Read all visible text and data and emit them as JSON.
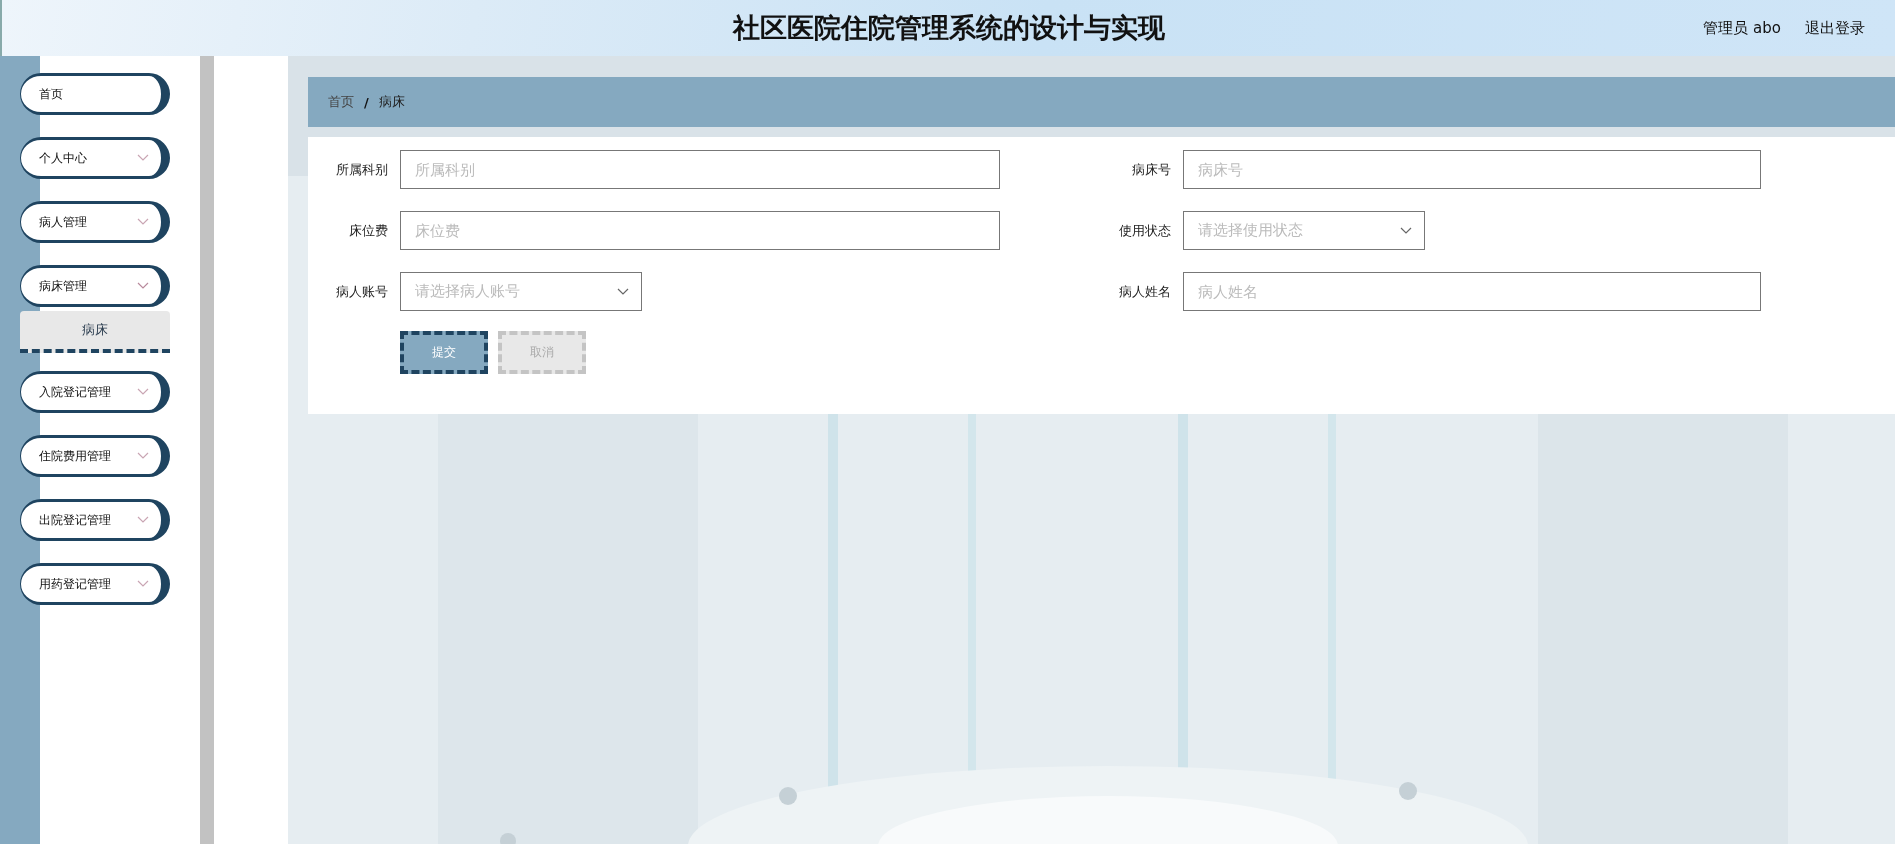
{
  "header": {
    "title": "社区医院住院管理系统的设计与实现",
    "user": "管理员 abo",
    "logout": "退出登录"
  },
  "sidebar": {
    "items": [
      {
        "label": "首页",
        "kind": "link"
      },
      {
        "label": "个人中心",
        "kind": "menu",
        "expanded": false
      },
      {
        "label": "病人管理",
        "kind": "menu",
        "expanded": false
      },
      {
        "label": "病床管理",
        "kind": "menu",
        "expanded": true,
        "children": [
          {
            "label": "病床",
            "selected": true
          }
        ]
      },
      {
        "label": "入院登记管理",
        "kind": "menu",
        "expanded": false
      },
      {
        "label": "住院费用管理",
        "kind": "menu",
        "expanded": false
      },
      {
        "label": "出院登记管理",
        "kind": "menu",
        "expanded": false
      },
      {
        "label": "用药登记管理",
        "kind": "menu",
        "expanded": false
      }
    ]
  },
  "breadcrumb": {
    "items": [
      "首页",
      "病床"
    ],
    "separator": "/"
  },
  "form": {
    "fields": [
      {
        "label": "所属科别",
        "kind": "text",
        "placeholder": "所属科别"
      },
      {
        "label": "病床号",
        "kind": "text",
        "placeholder": "病床号"
      },
      {
        "label": "床位费",
        "kind": "text",
        "placeholder": "床位费"
      },
      {
        "label": "使用状态",
        "kind": "select",
        "placeholder": "请选择使用状态"
      },
      {
        "label": "病人账号",
        "kind": "select",
        "placeholder": "请选择病人账号"
      },
      {
        "label": "病人姓名",
        "kind": "text",
        "placeholder": "病人姓名"
      }
    ],
    "buttons": [
      {
        "label": "提交",
        "kind": "primary"
      },
      {
        "label": "取消",
        "kind": "secondary"
      }
    ]
  }
}
